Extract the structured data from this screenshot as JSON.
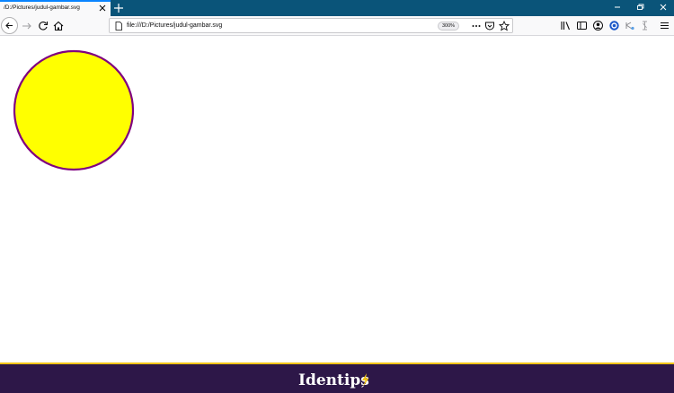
{
  "browser": {
    "tab": {
      "title": "/D:/Pictures/judul-gambar.svg",
      "close_icon": "close-icon"
    },
    "new_tab_icon": "plus-icon",
    "window_controls": [
      "minimize-icon",
      "restore-icon",
      "close-icon"
    ],
    "nav": {
      "back_icon": "arrow-left-icon",
      "forward_icon": "arrow-right-icon",
      "reload_icon": "reload-icon",
      "home_icon": "home-icon"
    },
    "address_bar": {
      "url": "file:///D:/Pictures/judul-gambar.svg",
      "page_icon": "page-icon",
      "zoom_level": "300%",
      "actions": [
        "more-actions-icon",
        "pocket-icon",
        "bookmark-star-icon"
      ]
    },
    "toolbar_icons": [
      "library-icon",
      "sidebar-icon",
      "account-icon",
      "extension-icon",
      "extension-icon",
      "extension-icon",
      "menu-icon"
    ]
  },
  "document": {
    "shape": "circle",
    "fill": "#ffff00",
    "stroke": "#800080"
  },
  "watermark": {
    "text": "Identips",
    "background": "#2d1748",
    "accent": "#f2c418"
  },
  "colors": {
    "tabstrip": "#0a5479",
    "tab_accent": "#0a84ff",
    "toolbar": "#f9f9fa"
  }
}
